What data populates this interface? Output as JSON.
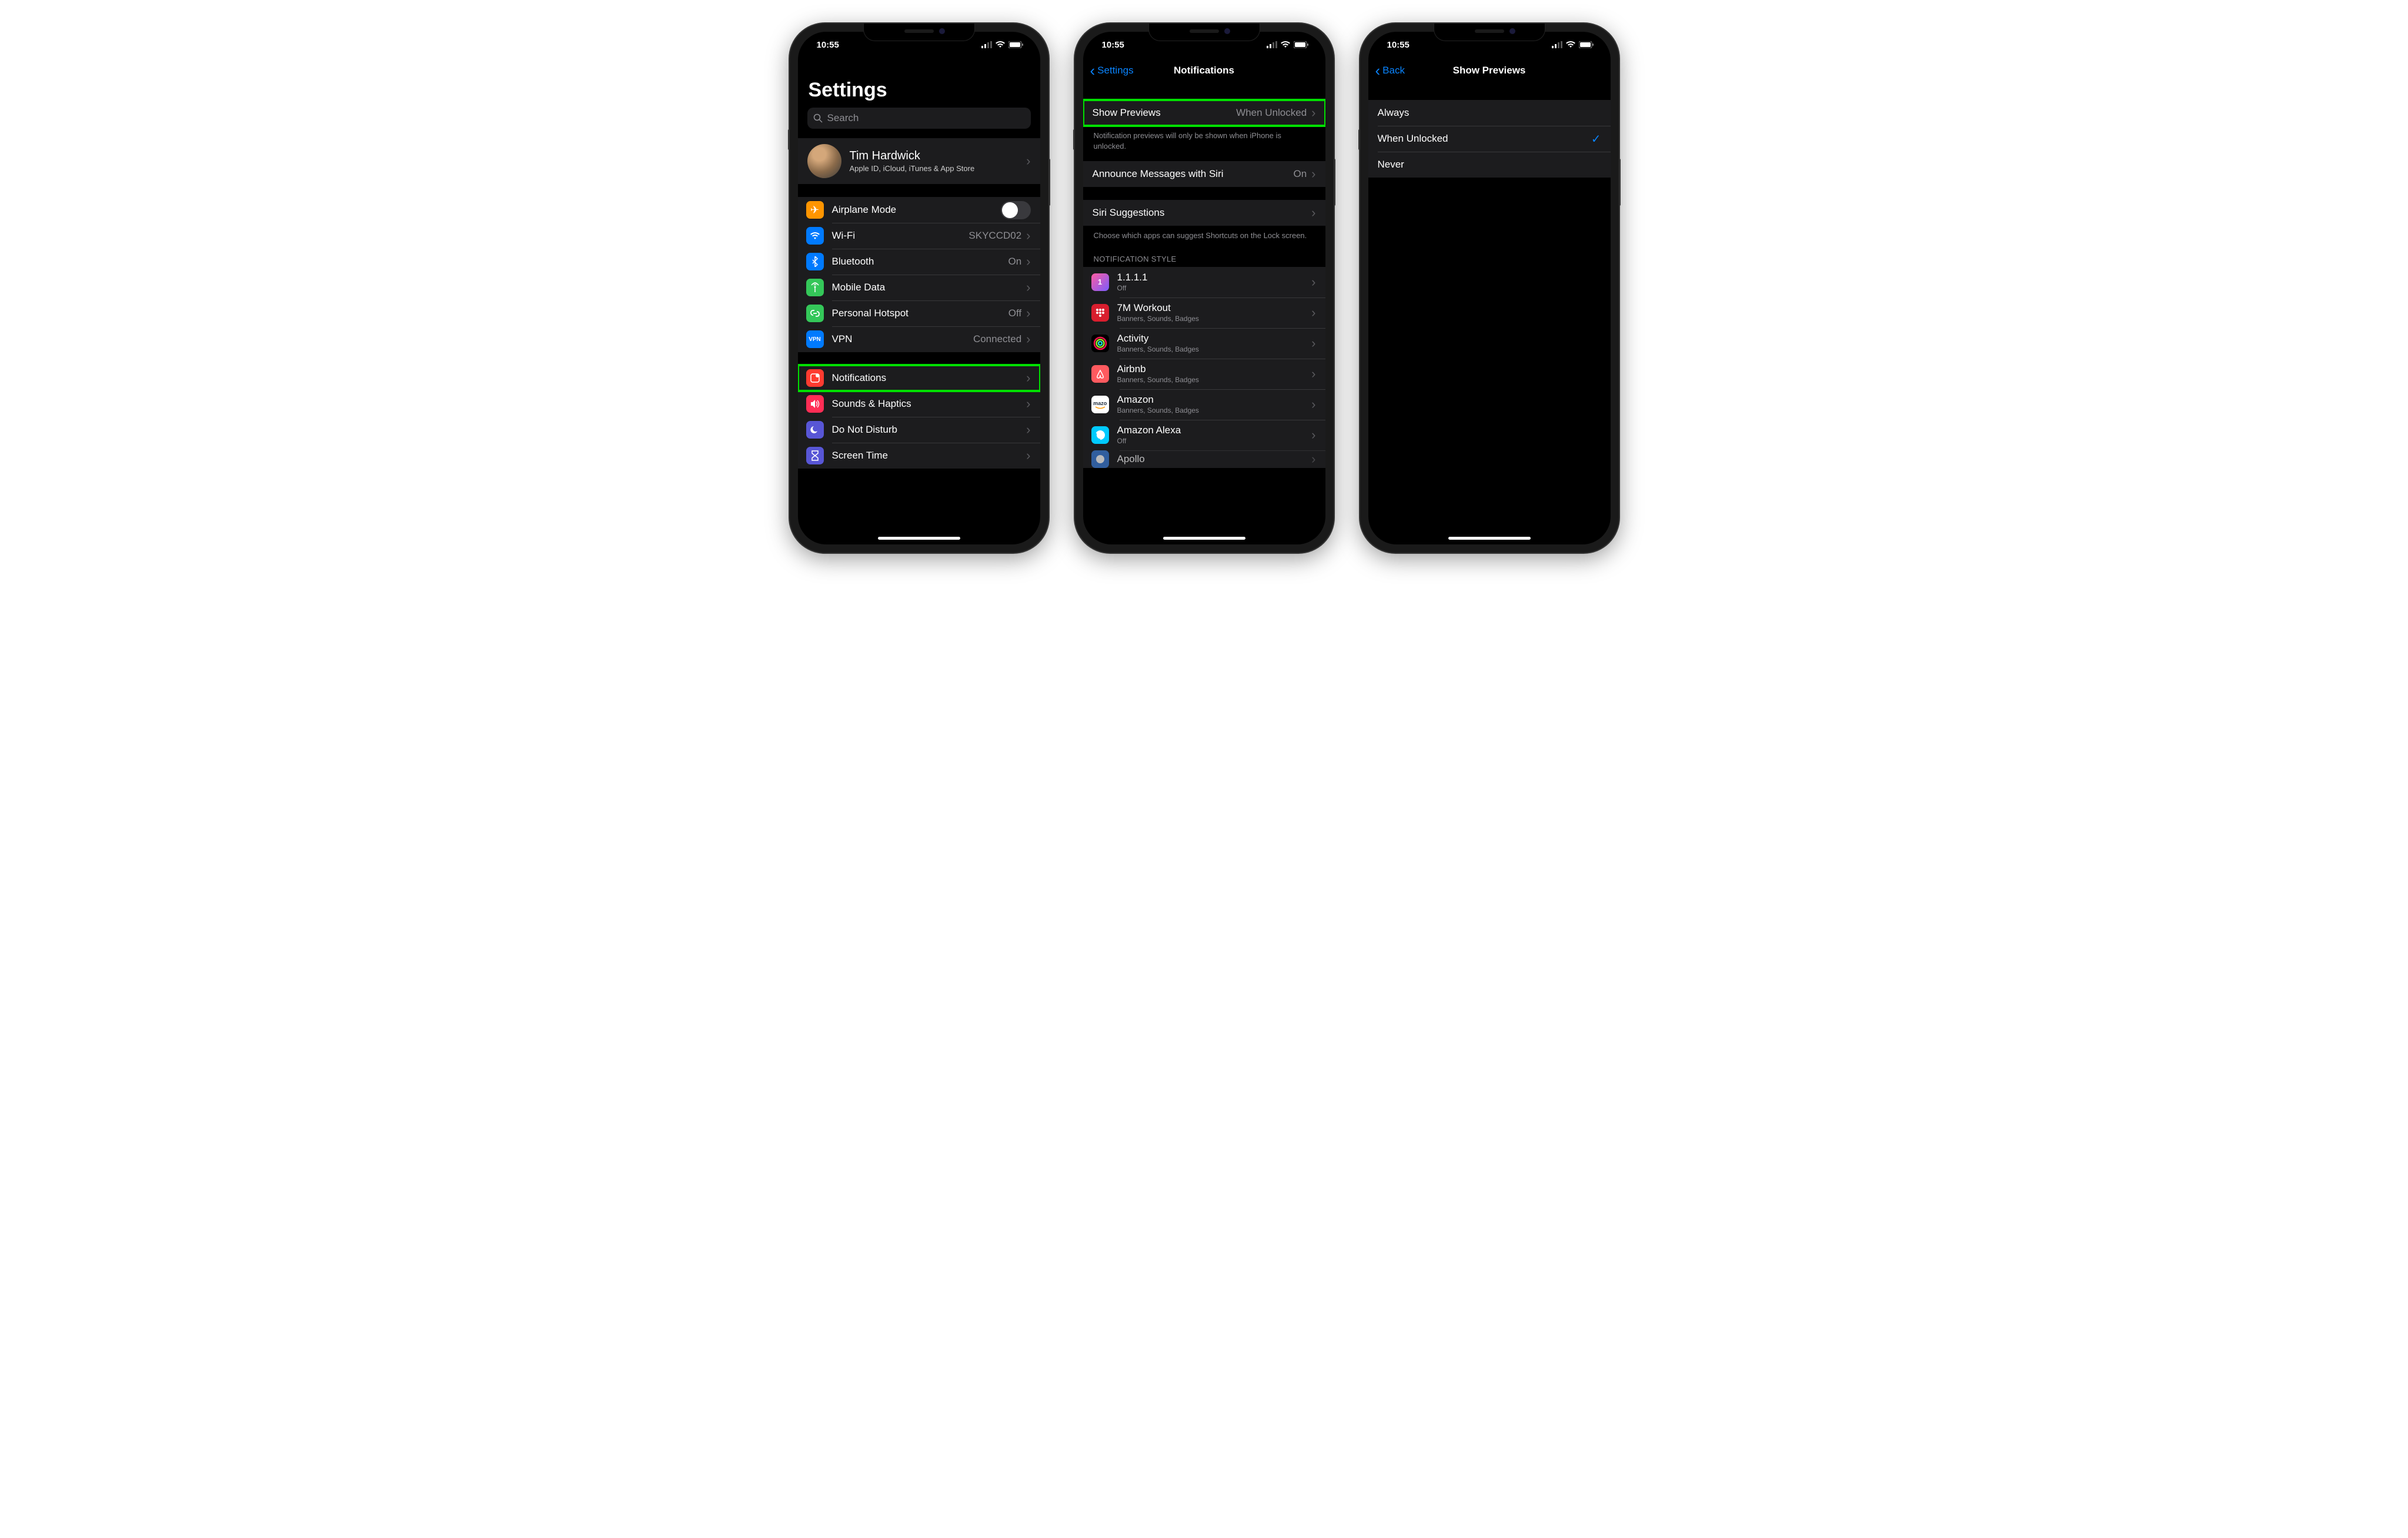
{
  "status": {
    "time": "10:55"
  },
  "colors": {
    "orange": "#ff9500",
    "blue": "#007aff",
    "green": "#34c759",
    "red": "#ff3b30",
    "purple": "#5856d6",
    "pink": "#ff2d55",
    "indigo": "#5e5ce6",
    "teal": "#30b0c7",
    "gray": "#8e8e93"
  },
  "phone1": {
    "title": "Settings",
    "search_placeholder": "Search",
    "profile": {
      "name": "Tim Hardwick",
      "sub": "Apple ID, iCloud, iTunes & App Store"
    },
    "rows": [
      {
        "key": "airplane",
        "label": "Airplane Mode",
        "icon_bg": "#ff9500",
        "glyph": "✈",
        "type": "switch"
      },
      {
        "key": "wifi",
        "label": "Wi-Fi",
        "detail": "SKYCCD02",
        "icon_bg": "#007aff",
        "glyph": "wifi",
        "type": "nav"
      },
      {
        "key": "bluetooth",
        "label": "Bluetooth",
        "detail": "On",
        "icon_bg": "#007aff",
        "glyph": "bt",
        "type": "nav"
      },
      {
        "key": "mobile",
        "label": "Mobile Data",
        "icon_bg": "#34c759",
        "glyph": "ant",
        "type": "nav"
      },
      {
        "key": "hotspot",
        "label": "Personal Hotspot",
        "detail": "Off",
        "icon_bg": "#34c759",
        "glyph": "link",
        "type": "nav"
      },
      {
        "key": "vpn",
        "label": "VPN",
        "detail": "Connected",
        "icon_bg": "#007aff",
        "glyph": "VPN",
        "type": "nav",
        "text_icon": true
      }
    ],
    "rows2": [
      {
        "key": "notifications",
        "label": "Notifications",
        "icon_bg": "#ff3b30",
        "glyph": "notif",
        "type": "nav",
        "highlight": true
      },
      {
        "key": "sounds",
        "label": "Sounds & Haptics",
        "icon_bg": "#ff2d55",
        "glyph": "vol",
        "type": "nav"
      },
      {
        "key": "dnd",
        "label": "Do Not Disturb",
        "icon_bg": "#5856d6",
        "glyph": "moon",
        "type": "nav"
      },
      {
        "key": "screentime",
        "label": "Screen Time",
        "icon_bg": "#5856d6",
        "glyph": "hour",
        "type": "nav"
      }
    ]
  },
  "phone2": {
    "back": "Settings",
    "title": "Notifications",
    "rows_top": [
      {
        "key": "previews",
        "label": "Show Previews",
        "detail": "When Unlocked",
        "highlight": true
      }
    ],
    "footer_top": "Notification previews will only be shown when iPhone is unlocked.",
    "rows_mid": [
      {
        "key": "announce",
        "label": "Announce Messages with Siri",
        "detail": "On"
      }
    ],
    "rows_siri": [
      {
        "key": "siri_sugg",
        "label": "Siri Suggestions"
      }
    ],
    "footer_siri": "Choose which apps can suggest Shortcuts on the Lock screen.",
    "style_header": "NOTIFICATION STYLE",
    "apps": [
      {
        "key": "1111",
        "name": "1.1.1.1",
        "sub": "Off",
        "bg": "linear-gradient(135deg,#ff5ca0,#7a5cff)"
      },
      {
        "key": "7m",
        "name": "7M Workout",
        "sub": "Banners, Sounds, Badges",
        "bg": "#d91e2e"
      },
      {
        "key": "activity",
        "name": "Activity",
        "sub": "Banners, Sounds, Badges",
        "bg": "#000"
      },
      {
        "key": "airbnb",
        "name": "Airbnb",
        "sub": "Banners, Sounds, Badges",
        "bg": "#ff5a5f"
      },
      {
        "key": "amazon",
        "name": "Amazon",
        "sub": "Banners, Sounds, Badges",
        "bg": "#fff"
      },
      {
        "key": "alexa",
        "name": "Amazon Alexa",
        "sub": "Off",
        "bg": "#00caff"
      },
      {
        "key": "apollo",
        "name": "Apollo",
        "sub": "",
        "bg": "#3a7bd5"
      }
    ]
  },
  "phone3": {
    "back": "Back",
    "title": "Show Previews",
    "options": [
      {
        "key": "always",
        "label": "Always",
        "selected": false
      },
      {
        "key": "unlocked",
        "label": "When Unlocked",
        "selected": true
      },
      {
        "key": "never",
        "label": "Never",
        "selected": false
      }
    ]
  }
}
